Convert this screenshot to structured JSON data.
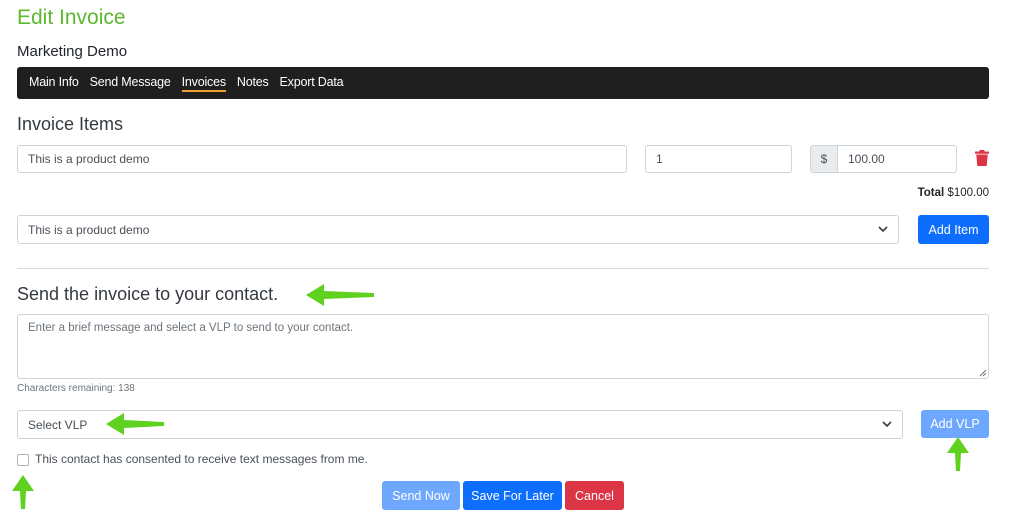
{
  "header": {
    "title": "Edit Invoice",
    "subtitle": "Marketing Demo"
  },
  "nav": {
    "items": [
      {
        "label": "Main Info"
      },
      {
        "label": "Send Message"
      },
      {
        "label": "Invoices"
      },
      {
        "label": "Notes"
      },
      {
        "label": "Export Data"
      }
    ],
    "active": "Invoices"
  },
  "invoice_items": {
    "title": "Invoice Items",
    "item": {
      "description": "This is a product demo",
      "quantity": "1",
      "currency_symbol": "$",
      "price": "100.00"
    },
    "total_label": "Total",
    "total_value": "$100.00",
    "product_select_value": "This is a product demo",
    "add_item_label": "Add Item"
  },
  "send": {
    "title": "Send the invoice to your contact.",
    "message_placeholder": "Enter a brief message and select a VLP to send to your contact.",
    "chars_remaining": "Characters remaining: 138",
    "vlp_select_value": "Select VLP",
    "add_vlp_label": "Add VLP",
    "consent_label": "This contact has consented to receive text messages from me.",
    "consent_checked": false
  },
  "actions": {
    "send_now": "Send Now",
    "save_for_later": "Save For Later",
    "cancel": "Cancel"
  },
  "colors": {
    "title_green": "#5cb82e",
    "navbar_bg": "#1f1f1f",
    "nav_active_underline": "#f0a030",
    "primary": "#0d6efd",
    "primary_light": "#6ea8fe",
    "danger": "#dc3545",
    "annotation_arrow": "#5fd11e"
  }
}
